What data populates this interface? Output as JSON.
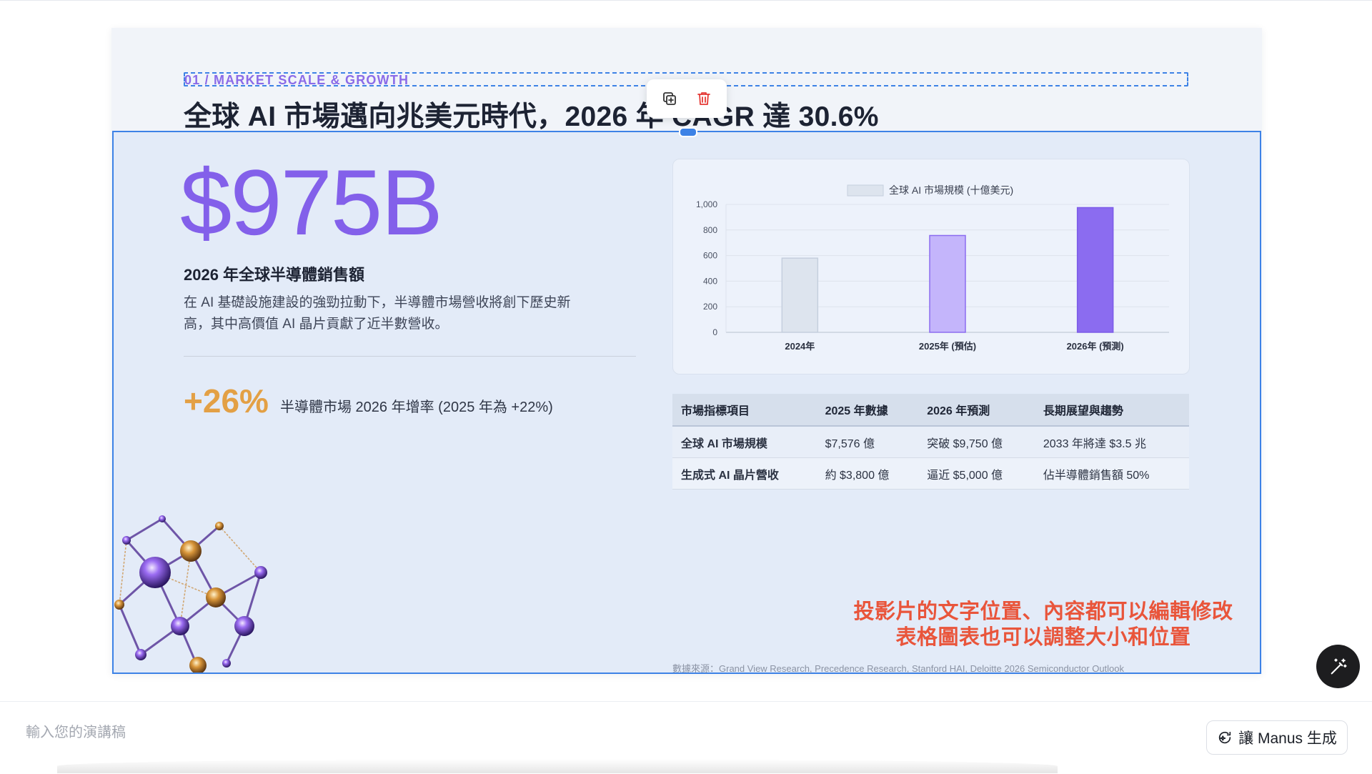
{
  "slide": {
    "eyebrow": "01 / MARKET SCALE & GROWTH",
    "headline": "全球 AI 市場邁向兆美元時代，2026 年 CAGR 達 30.6%",
    "big_stat": "$975B",
    "big_stat_label": "2026 年全球半導體銷售額",
    "description": "在 AI 基礎設施建設的強勁拉動下，半導體市場營收將創下歷史新高，其中高價值 AI 晶片貢獻了近半數營收。",
    "growth_value": "+26%",
    "growth_desc": "半導體市場 2026 年增率 (2025 年為 +22%)",
    "note_lines": [
      "投影片的文字位置、內容都可以編輯修改",
      "表格圖表也可以調整大小和位置"
    ],
    "source": "數據來源：Grand View Research, Precedence Research, Stanford HAI, Deloitte 2026 Semiconductor Outlook"
  },
  "chart_data": {
    "type": "bar",
    "categories": [
      "2024年",
      "2025年 (預估)",
      "2026年 (預測)"
    ],
    "series": [
      {
        "name": "全球 AI 市場規模 (十億美元)",
        "values": [
          580,
          757,
          975
        ]
      }
    ],
    "bar_colors": [
      "#dde4ee",
      "#c4b5fb",
      "#8b6cf0"
    ],
    "bar_borders": [
      "#c5cfde",
      "#8b6cf0",
      "#7c5ce8"
    ],
    "ylim": [
      0,
      1000
    ],
    "yticks": [
      "0",
      "200",
      "400",
      "600",
      "800",
      "1,000"
    ],
    "legend_position": "top-center",
    "grid": true,
    "title": "",
    "xlabel": "",
    "ylabel": ""
  },
  "table": {
    "headers": [
      "市場指標項目",
      "2025 年數據",
      "2026 年預測",
      "長期展望與趨勢"
    ],
    "rows": [
      [
        "全球 AI 市場規模",
        "$7,576 億",
        "突破 $9,750 億",
        "2033 年將達 $3.5 兆"
      ],
      [
        "生成式 AI 晶片營收",
        "約 $3,800 億",
        "逼近 $5,000 億",
        "佔半導體銷售額 50%"
      ]
    ]
  },
  "toolbar": {
    "duplicate_icon": "duplicate-icon",
    "delete_icon": "trash-icon"
  },
  "bottom": {
    "script_placeholder": "輸入您的演講稿",
    "manus_label": "讓 Manus 生成"
  },
  "colors": {
    "accent_purple": "#8360ea",
    "accent_orange": "#e3a045",
    "selection_blue": "#3d82e6",
    "note_red": "#e9553b"
  }
}
